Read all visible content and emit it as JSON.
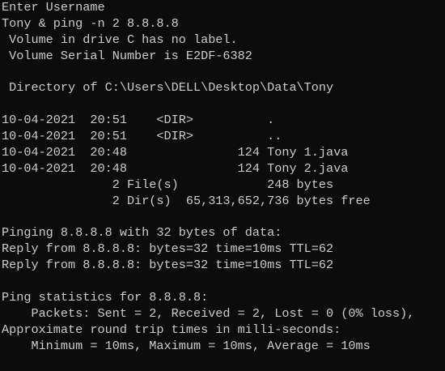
{
  "console": {
    "lines": [
      "Enter Username",
      "Tony & ping -n 2 8.8.8.8",
      " Volume in drive C has no label.",
      " Volume Serial Number is E2DF-6382",
      "",
      " Directory of C:\\Users\\DELL\\Desktop\\Data\\Tony",
      "",
      "10-04-2021  20:51    <DIR>          .",
      "10-04-2021  20:51    <DIR>          ..",
      "10-04-2021  20:48               124 Tony 1.java",
      "10-04-2021  20:48               124 Tony 2.java",
      "               2 File(s)            248 bytes",
      "               2 Dir(s)  65,313,652,736 bytes free",
      "",
      "Pinging 8.8.8.8 with 32 bytes of data:",
      "Reply from 8.8.8.8: bytes=32 time=10ms TTL=62",
      "Reply from 8.8.8.8: bytes=32 time=10ms TTL=62",
      "",
      "Ping statistics for 8.8.8.8:",
      "    Packets: Sent = 2, Received = 2, Lost = 0 (0% loss),",
      "Approximate round trip times in milli-seconds:",
      "    Minimum = 10ms, Maximum = 10ms, Average = 10ms"
    ]
  },
  "colors": {
    "background": "#0c0c0c",
    "text": "#cccccc"
  }
}
